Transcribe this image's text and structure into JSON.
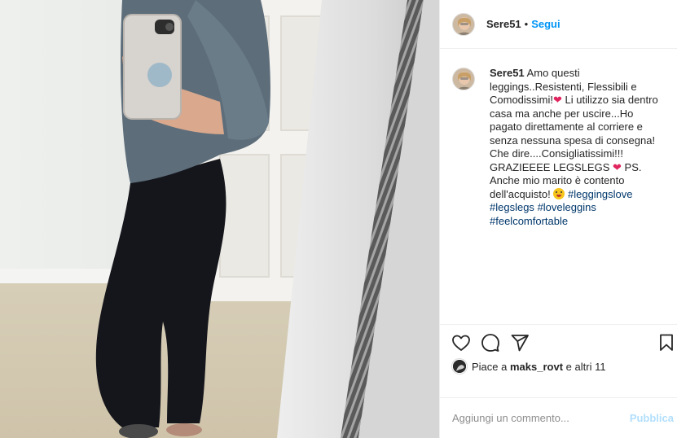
{
  "post": {
    "username": "Sere51",
    "separator": "•",
    "follow_label": "Segui"
  },
  "caption": {
    "username": "Sere51",
    "text_1": "Amo questi leggings..Resistenti, Flessibili e Comodissimi!",
    "text_2": " Li utilizzo sia dentro casa ma anche per uscire...Ho pagato direttamente al corriere e senza nessuna spesa di consegna! Che dire....Consigliatissimi!!! GRAZIEEEE LEGSLEGS ",
    "text_3": " PS. Anche mio marito è contento dell'acquisto! ",
    "heart_glyph": "❤",
    "emoji_icon": "winking-tongue-face-emoji",
    "hashtags": [
      "#leggingslove",
      "#legslegs",
      "#loveleggins",
      "#feelcomfortable"
    ]
  },
  "actions": {
    "like_icon": "heart-outline-icon",
    "comment_icon": "comment-bubble-icon",
    "share_icon": "paper-plane-icon",
    "save_icon": "bookmark-icon"
  },
  "likes": {
    "prefix": "Piace a ",
    "user": "maks_rovt",
    "suffix": " e altri 11"
  },
  "comment": {
    "placeholder": "Aggiungi un commento...",
    "publish_label": "Pubblica"
  },
  "colors": {
    "link_blue": "#0095f6",
    "hashtag_blue": "#00376b",
    "publish_disabled": "#b2dffc",
    "heart_red": "#e0245e"
  }
}
